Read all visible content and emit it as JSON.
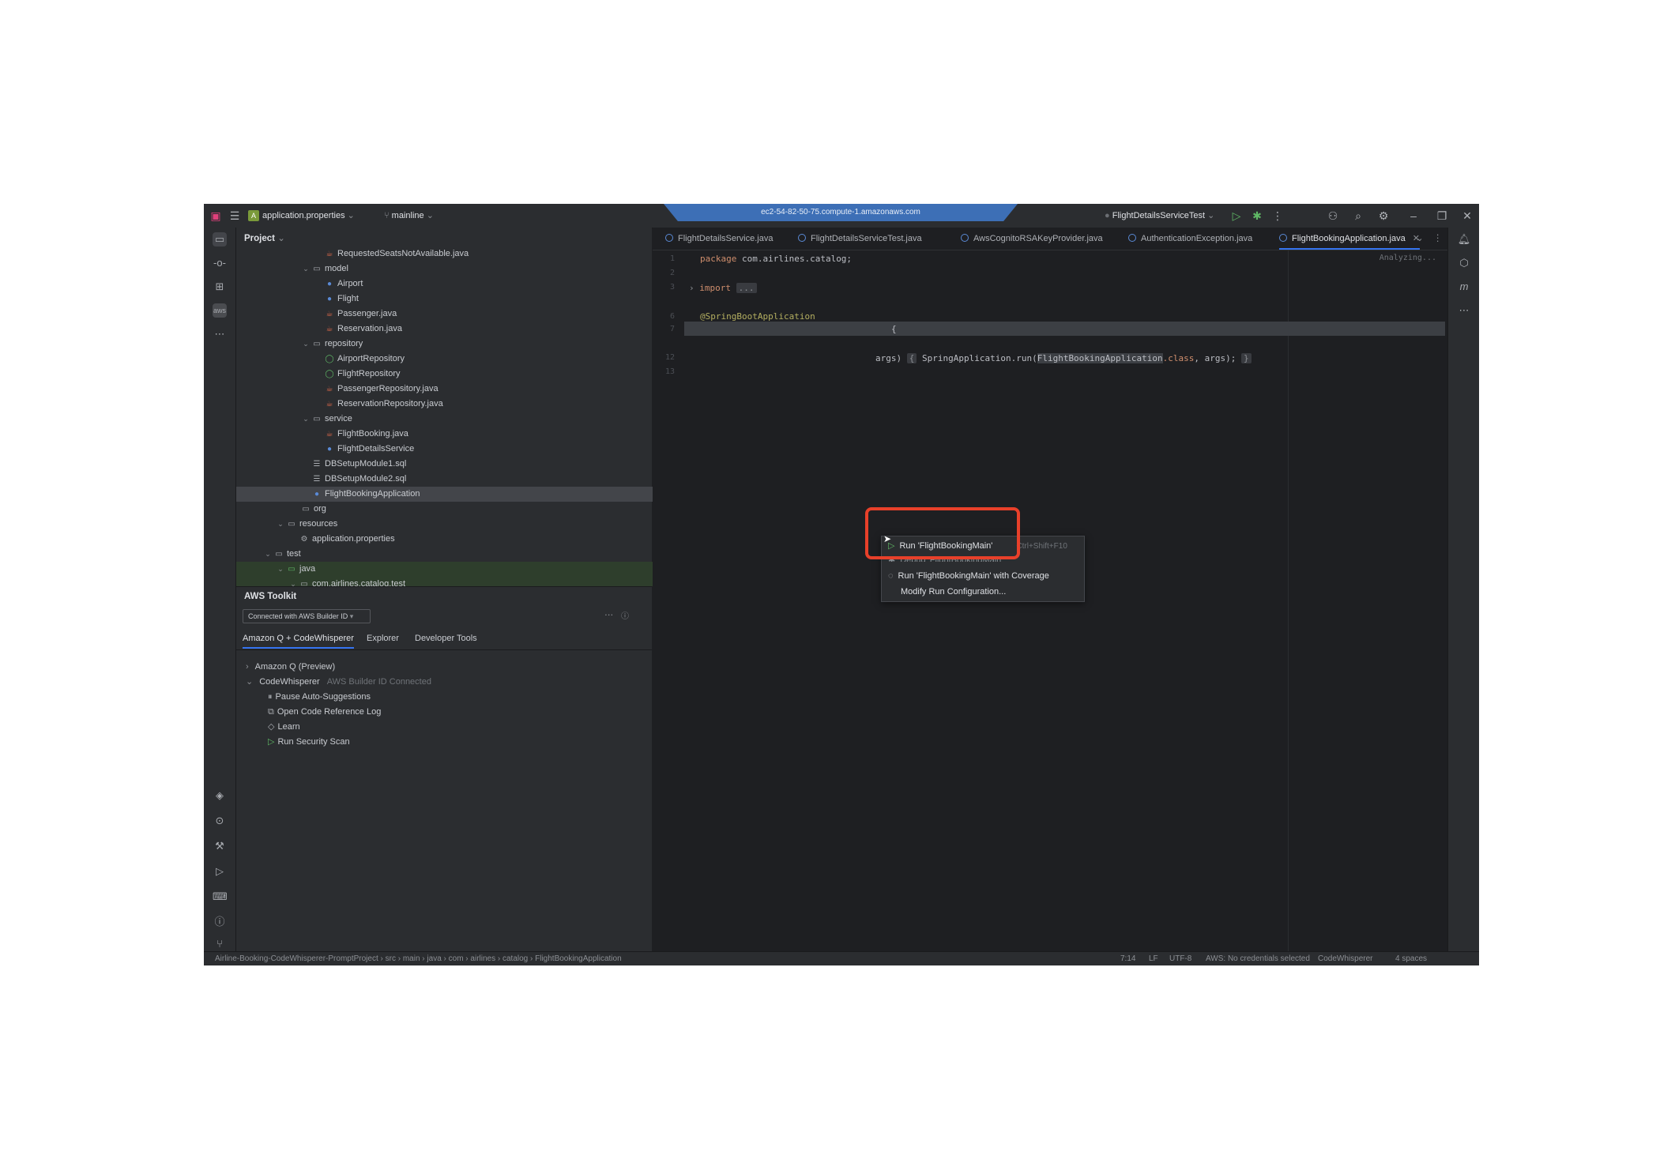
{
  "titlebar": {
    "project_badge": "A",
    "file": "application.properties",
    "branch": "mainline",
    "remote_host": "ec2-54-82-50-75.compute-1.amazonaws.com",
    "run_config": "FlightDetailsServiceTest"
  },
  "project_panel": {
    "title": "Project",
    "tree": [
      {
        "label": "RequestedSeatsNotAvailable.java",
        "kind": "java"
      },
      {
        "label": "model",
        "kind": "folder"
      },
      {
        "label": "Airport",
        "kind": "class"
      },
      {
        "label": "Flight",
        "kind": "class"
      },
      {
        "label": "Passenger.java",
        "kind": "java"
      },
      {
        "label": "Reservation.java",
        "kind": "java"
      },
      {
        "label": "repository",
        "kind": "folder"
      },
      {
        "label": "AirportRepository",
        "kind": "interface"
      },
      {
        "label": "FlightRepository",
        "kind": "interface"
      },
      {
        "label": "PassengerRepository.java",
        "kind": "java"
      },
      {
        "label": "ReservationRepository.java",
        "kind": "java"
      },
      {
        "label": "service",
        "kind": "folder"
      },
      {
        "label": "FlightBooking.java",
        "kind": "java"
      },
      {
        "label": "FlightDetailsService",
        "kind": "class"
      },
      {
        "label": "DBSetupModule1.sql",
        "kind": "sql"
      },
      {
        "label": "DBSetupModule2.sql",
        "kind": "sql"
      },
      {
        "label": "FlightBookingApplication",
        "kind": "class"
      },
      {
        "label": "org",
        "kind": "folder"
      },
      {
        "label": "resources",
        "kind": "folder"
      },
      {
        "label": "application.properties",
        "kind": "properties"
      },
      {
        "label": "test",
        "kind": "folder"
      },
      {
        "label": "java",
        "kind": "folder"
      },
      {
        "label": "com.airlines.catalog.test",
        "kind": "folder"
      }
    ]
  },
  "aws_toolkit": {
    "title": "AWS Toolkit",
    "connection": "Connected with AWS Builder ID",
    "tabs": [
      "Amazon Q + CodeWhisperer",
      "Explorer",
      "Developer Tools"
    ],
    "items": [
      {
        "label": "Amazon Q (Preview)",
        "note": ""
      },
      {
        "label": "CodeWhisperer",
        "note": "AWS Builder ID Connected"
      },
      {
        "label": "Pause Auto-Suggestions",
        "note": ""
      },
      {
        "label": "Open Code Reference Log",
        "note": ""
      },
      {
        "label": "Learn",
        "note": ""
      },
      {
        "label": "Run Security Scan",
        "note": ""
      }
    ]
  },
  "editor": {
    "tabs": [
      "FlightDetailsService.java",
      "FlightDetailsServiceTest.java",
      "AwsCognitoRSAKeyProvider.java",
      "AuthenticationException.java",
      "FlightBookingApplication.java"
    ],
    "status_hint": "Analyzing...",
    "line_numbers": [
      "1",
      "2",
      "3",
      "6",
      "7",
      "12",
      "13"
    ],
    "code": {
      "package_kw": "package",
      "package_name": " com.airlines.catalog;",
      "import_kw": "import",
      "import_fold": "...",
      "annotation": "@SpringBootApplication",
      "class_tail": "{",
      "main_args": "args)",
      "main_body_open": "{",
      "main_call": " SpringApplication.run(",
      "main_class_ref": "FlightBookingApplication",
      "main_class_kw": ".class",
      "main_args_end": ", args); ",
      "main_body_close": "}"
    }
  },
  "popup": {
    "run_label": "Run 'FlightBookingMain'",
    "run_shortcut": "Ctrl+Shift+F10",
    "debug_label": "Debug 'FlightBookingMain'",
    "coverage_label": "Run 'FlightBookingMain' with Coverage",
    "modify_label": "Modify Run Configuration..."
  },
  "statusbar": {
    "breadcrumb": "Airline-Booking-CodeWhisperer-PromptProject  ›  src  ›  main  ›  java  ›  com  ›  airlines  ›  catalog  ›  FlightBookingApplication",
    "position": "7:14",
    "line_sep": "LF",
    "encoding": "UTF-8",
    "aws": "AWS: No credentials selected",
    "cw": "CodeWhisperer",
    "indent": "4 spaces"
  },
  "colors": {
    "accent": "#3574f0",
    "highlight_box": "#e8402a",
    "remote_bar": "#3d6fb6"
  }
}
